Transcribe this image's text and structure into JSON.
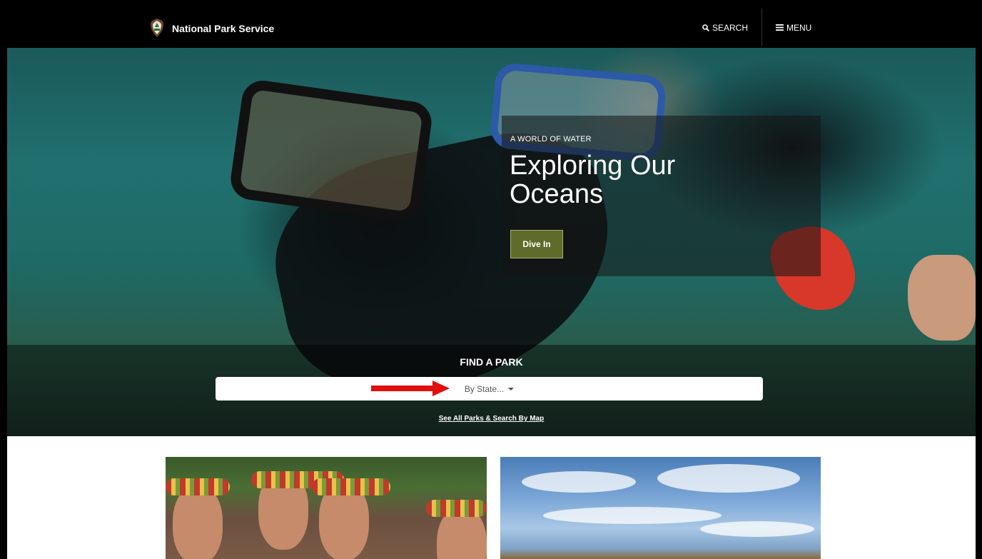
{
  "nav": {
    "site_title": "National Park Service",
    "search_label": "SEARCH",
    "menu_label": "MENU"
  },
  "hero": {
    "eyebrow": "A WORLD OF WATER",
    "headline": "Exploring Our Oceans",
    "cta_label": "Dive In"
  },
  "find_park": {
    "title": "FIND A PARK",
    "select_value": "By State...",
    "see_all_link": "See All Parks & Search By Map"
  },
  "colors": {
    "nav_bg": "#000000",
    "cta_bg": "#5e6b2a",
    "annotation_arrow": "#e01010"
  },
  "icons": {
    "logo": "nps-arrowhead-icon",
    "search": "search-icon",
    "menu": "hamburger-icon",
    "dropdown": "caret-down-icon"
  }
}
